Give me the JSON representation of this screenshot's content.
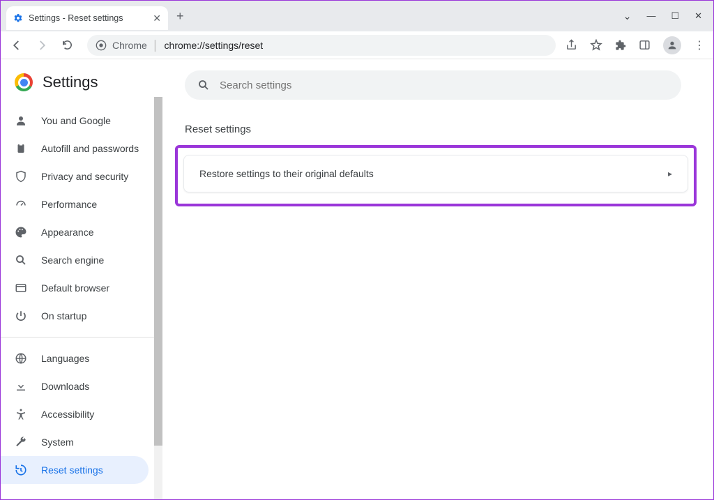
{
  "tab": {
    "title": "Settings - Reset settings"
  },
  "url": {
    "scheme": "Chrome",
    "path": "chrome://settings/reset"
  },
  "header": {
    "title": "Settings"
  },
  "search": {
    "placeholder": "Search settings"
  },
  "sidebar": {
    "items": [
      {
        "label": "You and Google"
      },
      {
        "label": "Autofill and passwords"
      },
      {
        "label": "Privacy and security"
      },
      {
        "label": "Performance"
      },
      {
        "label": "Appearance"
      },
      {
        "label": "Search engine"
      },
      {
        "label": "Default browser"
      },
      {
        "label": "On startup"
      }
    ],
    "items2": [
      {
        "label": "Languages"
      },
      {
        "label": "Downloads"
      },
      {
        "label": "Accessibility"
      },
      {
        "label": "System"
      },
      {
        "label": "Reset settings"
      }
    ]
  },
  "section": {
    "title": "Reset settings"
  },
  "card": {
    "label": "Restore settings to their original defaults"
  }
}
